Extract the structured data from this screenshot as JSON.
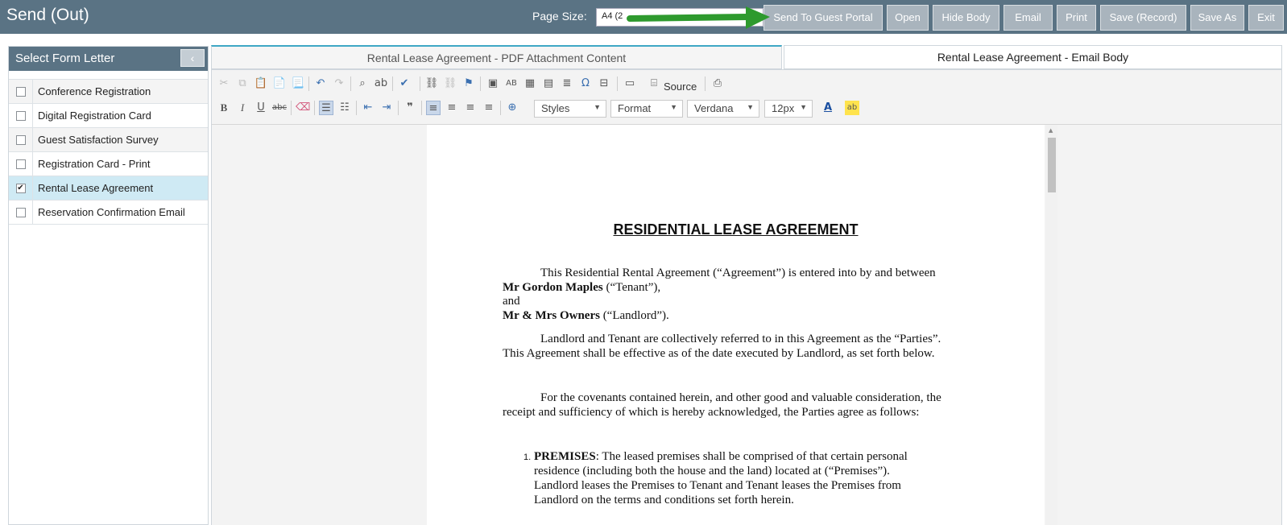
{
  "app": {
    "title": "Send (Out)"
  },
  "header": {
    "page_size_label": "Page Size:",
    "page_size_value": "A4 (2",
    "buttons": {
      "send_portal": "Send To Guest Portal",
      "open": "Open",
      "hide_body": "Hide Body",
      "email": "Email",
      "print": "Print",
      "save_record": "Save (Record)",
      "save_as": "Save As",
      "exit": "Exit"
    }
  },
  "sidebar": {
    "title": "Select Form Letter",
    "collapse_glyph": "‹",
    "items": [
      {
        "label": "Conference Registration",
        "checked": ""
      },
      {
        "label": "Digital Registration Card",
        "checked": ""
      },
      {
        "label": "Guest Satisfaction Survey",
        "checked": ""
      },
      {
        "label": "Registration Card - Print",
        "checked": ""
      },
      {
        "label": "Rental Lease Agreement",
        "checked": "✔"
      },
      {
        "label": "Reservation Confirmation Email",
        "checked": ""
      }
    ]
  },
  "tabs": {
    "pdf": "Rental Lease Agreement - PDF Attachment Content",
    "email": "Rental Lease Agreement - Email Body"
  },
  "editor": {
    "source_label": "Source",
    "styles": "Styles",
    "format": "Format",
    "font": "Verdana",
    "size": "12px",
    "accent_color": "#3fa7c5"
  },
  "document": {
    "title": "RESIDENTIAL LEASE AGREEMENT",
    "p1_line1": "This Residential Rental Agreement (“Agreement”) is entered into by and between",
    "tenant_name": "Mr Gordon Maples",
    "tenant_suffix": " (“Tenant”),",
    "and": "and",
    "landlord_name": "Mr & Mrs Owners",
    "landlord_suffix": " (“Landlord”).",
    "p2_line1": "Landlord and Tenant are collectively referred to in this Agreement as the “Parties”.",
    "p2_line2": "This Agreement shall be effective as of the date executed by Landlord, as set forth below.",
    "p3_line1": "For the covenants contained herein, and other good and valuable consideration, the",
    "p3_line2": "receipt and sufficiency of which is hereby acknowledged, the Parties agree as follows:",
    "list_num": "1.",
    "premises_label": "PREMISES",
    "premises_line1": ":  The leased premises shall be comprised of that certain personal",
    "premises_line2": "residence (including both the house and the land) located at  (“Premises”).",
    "premises_line3": "Landlord leases the Premises to Tenant and Tenant leases the Premises from",
    "premises_line4": "Landlord on the terms and conditions set forth herein."
  }
}
